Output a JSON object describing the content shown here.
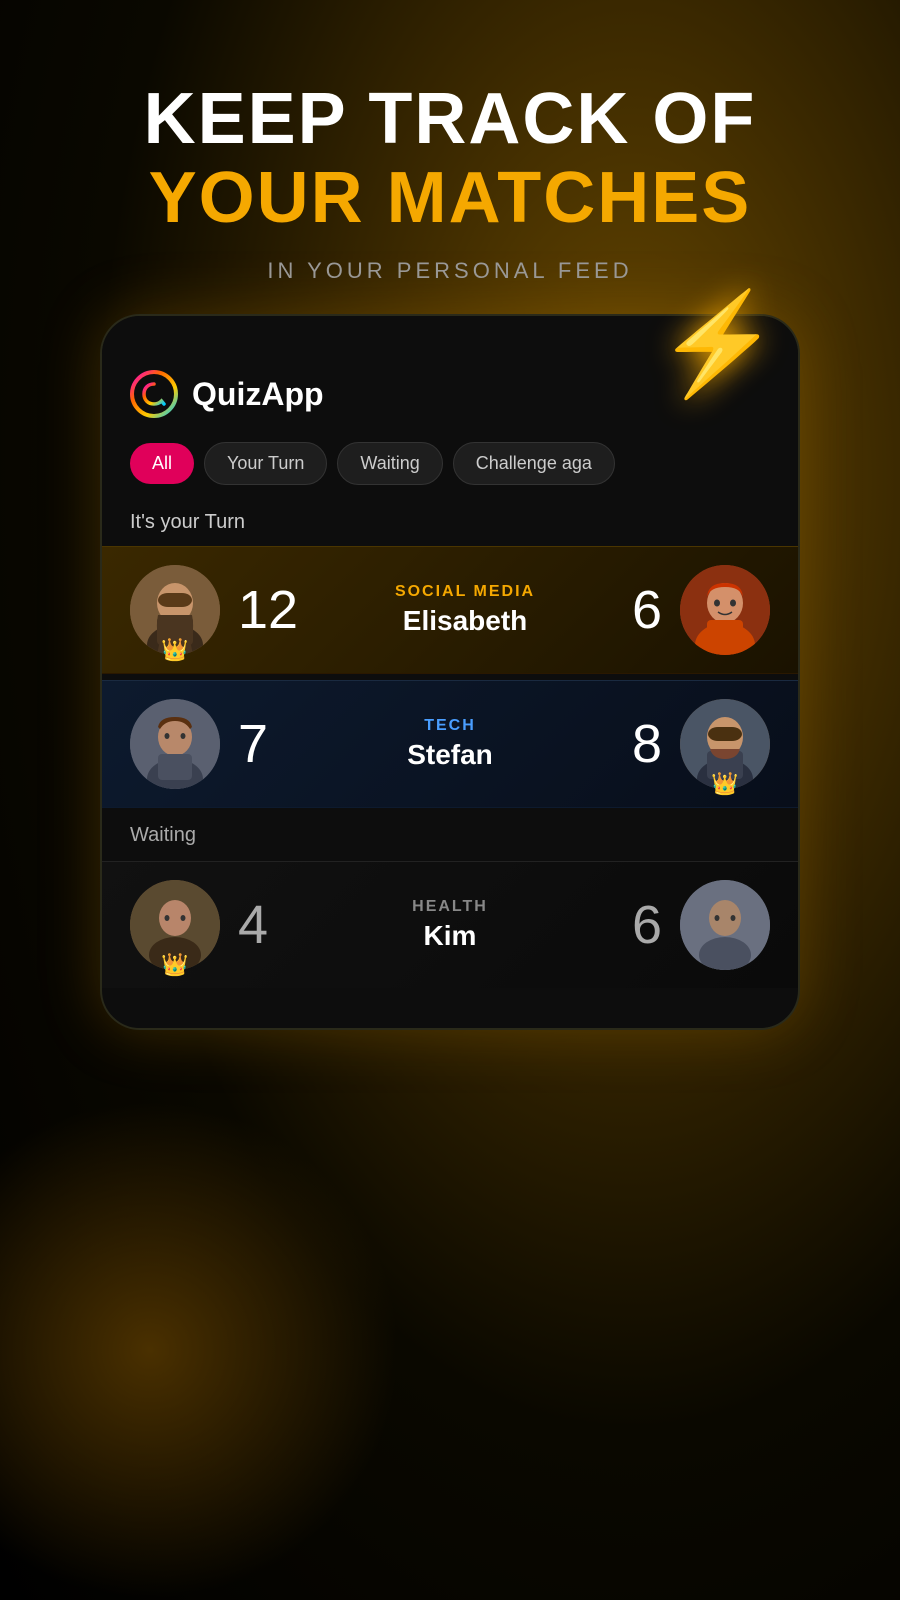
{
  "headline": {
    "line1": "KEEP TRACK OF",
    "line2": "YOUR MATCHES",
    "sub": "IN YOUR PERSONAL FEED"
  },
  "lightning": "⚡",
  "app": {
    "name": "QuizApp"
  },
  "tabs": [
    {
      "id": "all",
      "label": "All",
      "active": true
    },
    {
      "id": "your-turn",
      "label": "Your Turn",
      "active": false
    },
    {
      "id": "waiting",
      "label": "Waiting",
      "active": false
    },
    {
      "id": "challenge",
      "label": "Challenge aga",
      "active": false
    }
  ],
  "sections": {
    "your_turn_label": "It's your Turn",
    "waiting_label": "Waiting"
  },
  "matches": [
    {
      "id": 1,
      "type": "your-turn",
      "category": "SOCIAL MEDIA",
      "opponent": "Elisabeth",
      "score_left": "12",
      "score_right": "6",
      "left_has_crown": true,
      "right_has_crown": false,
      "left_avatar": "bearded",
      "right_avatar": "redhead"
    },
    {
      "id": 2,
      "type": "waiting",
      "category": "TECH",
      "opponent": "Stefan",
      "score_left": "7",
      "score_right": "8",
      "left_has_crown": false,
      "right_has_crown": true,
      "left_avatar": "male2",
      "right_avatar": "bearded"
    },
    {
      "id": 3,
      "type": "waiting",
      "category": "HEALTH",
      "opponent": "Kim",
      "score_left": "4",
      "score_right": "6",
      "left_has_crown": false,
      "right_has_crown": false,
      "left_avatar": "bearded",
      "right_avatar": "bald"
    }
  ],
  "crown_emoji": "👑"
}
